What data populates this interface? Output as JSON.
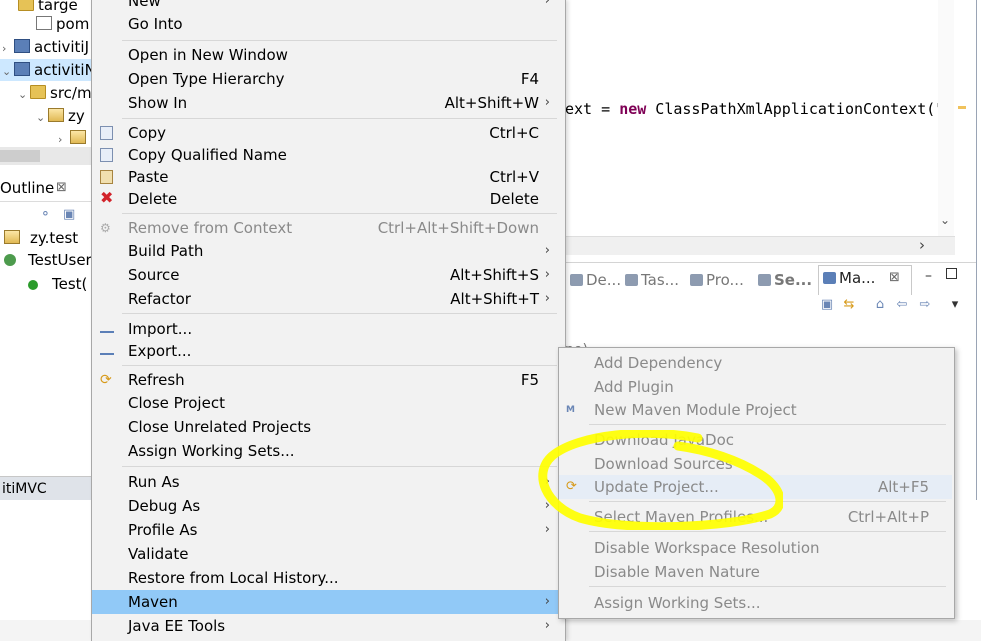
{
  "explorer": {
    "rows": [
      {
        "label": "targe"
      },
      {
        "label": "pom"
      },
      {
        "label": "activitiJ"
      },
      {
        "label": "activitiN"
      },
      {
        "label": "src/m"
      },
      {
        "label": "zy"
      }
    ]
  },
  "outline": {
    "tab_label": "Outline",
    "close": "⊠",
    "rows": [
      {
        "label": "zy.test"
      },
      {
        "label": "TestUser"
      },
      {
        "label": "Test("
      }
    ]
  },
  "status_left": "itiMVC",
  "editor": {
    "code_prefix": "ext = ",
    "code_keyword": "new",
    "code_suffix": " ClassPathXmlApplicationContext(\""
  },
  "panel": {
    "tabs": [
      {
        "label": "De..."
      },
      {
        "label": "Tas..."
      },
      {
        "label": "Pro..."
      },
      {
        "label": "Se..."
      }
    ],
    "active_tab": "Ma...",
    "active_close": "⊠",
    "body_text": "po)"
  },
  "menu": {
    "items": [
      {
        "label": "New",
        "accel": "",
        "submenu": true
      },
      {
        "label": "Go Into",
        "accel": "",
        "submenu": false
      },
      {
        "label": "Open in New Window",
        "accel": "",
        "submenu": false
      },
      {
        "label": "Open Type Hierarchy",
        "accel": "F4",
        "submenu": false
      },
      {
        "label": "Show In",
        "accel": "Alt+Shift+W",
        "submenu": true
      },
      {
        "label": "Copy",
        "accel": "Ctrl+C",
        "submenu": false
      },
      {
        "label": "Copy Qualified Name",
        "accel": "",
        "submenu": false
      },
      {
        "label": "Paste",
        "accel": "Ctrl+V",
        "submenu": false
      },
      {
        "label": "Delete",
        "accel": "Delete",
        "submenu": false
      },
      {
        "label": "Remove from Context",
        "accel": "Ctrl+Alt+Shift+Down",
        "submenu": false
      },
      {
        "label": "Build Path",
        "accel": "",
        "submenu": true
      },
      {
        "label": "Source",
        "accel": "Alt+Shift+S",
        "submenu": true
      },
      {
        "label": "Refactor",
        "accel": "Alt+Shift+T",
        "submenu": true
      },
      {
        "label": "Import...",
        "accel": "",
        "submenu": false
      },
      {
        "label": "Export...",
        "accel": "",
        "submenu": false
      },
      {
        "label": "Refresh",
        "accel": "F5",
        "submenu": false
      },
      {
        "label": "Close Project",
        "accel": "",
        "submenu": false
      },
      {
        "label": "Close Unrelated Projects",
        "accel": "",
        "submenu": false
      },
      {
        "label": "Assign Working Sets...",
        "accel": "",
        "submenu": false
      },
      {
        "label": "Run As",
        "accel": "",
        "submenu": true
      },
      {
        "label": "Debug As",
        "accel": "",
        "submenu": true
      },
      {
        "label": "Profile As",
        "accel": "",
        "submenu": true
      },
      {
        "label": "Validate",
        "accel": "",
        "submenu": false
      },
      {
        "label": "Restore from Local History...",
        "accel": "",
        "submenu": false
      },
      {
        "label": "Maven",
        "accel": "",
        "submenu": true
      },
      {
        "label": "Java EE Tools",
        "accel": "",
        "submenu": true
      }
    ]
  },
  "maven_submenu": {
    "items": [
      {
        "label": "Add Dependency",
        "accel": ""
      },
      {
        "label": "Add Plugin",
        "accel": ""
      },
      {
        "label": "New Maven Module Project",
        "accel": ""
      },
      {
        "label": "Download JavaDoc",
        "accel": ""
      },
      {
        "label": "Download Sources",
        "accel": ""
      },
      {
        "label": "Update Project...",
        "accel": "Alt+F5"
      },
      {
        "label": "Select Maven Profiles...",
        "accel": "Ctrl+Alt+P"
      },
      {
        "label": "Disable Workspace Resolution",
        "accel": ""
      },
      {
        "label": "Disable Maven Nature",
        "accel": ""
      },
      {
        "label": "Assign Working Sets...",
        "accel": ""
      }
    ]
  },
  "colors": {
    "menu_bg": "#f2f2f2",
    "selected": "#91c9f7",
    "annotation": "#ffff00",
    "keyword": "#7f0055"
  },
  "icons": {
    "chevron": "›",
    "arrow_down": "▾"
  }
}
